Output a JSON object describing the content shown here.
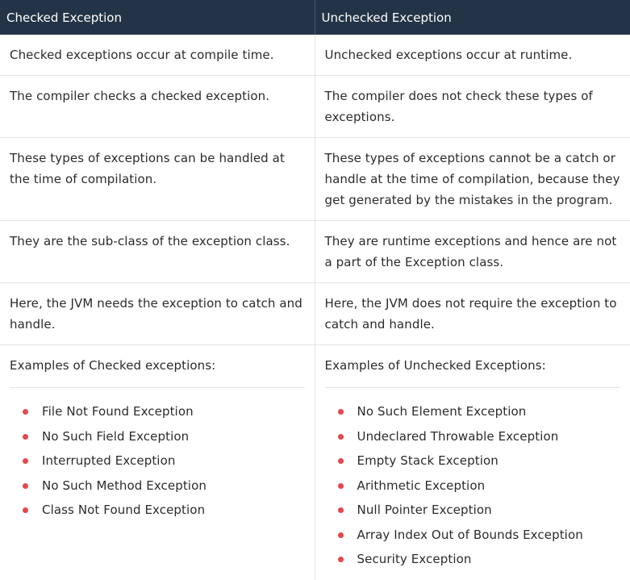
{
  "header": {
    "col1": "Checked Exception",
    "col2": "Unchecked Exception"
  },
  "rows": [
    {
      "checked": "Checked exceptions occur at compile time.",
      "unchecked": "Unchecked exceptions occur at runtime."
    },
    {
      "checked": "The compiler checks a checked exception.",
      "unchecked": "The compiler does not check these types of exceptions."
    },
    {
      "checked": "These types of exceptions can be handled at the time of compilation.",
      "unchecked": "These types of exceptions cannot be a catch or handle at the time of compilation, because they get generated by the mistakes in the program."
    },
    {
      "checked": "They are the sub-class of the exception class.",
      "unchecked": "They are runtime exceptions and hence are not a part of the Exception class."
    },
    {
      "checked": "Here, the JVM needs the exception to catch and handle.",
      "unchecked": "Here, the JVM does not require the exception to catch and handle."
    }
  ],
  "examples": {
    "checked_title": "Examples of Checked exceptions:",
    "unchecked_title": "Examples of Unchecked Exceptions:",
    "checked_items": [
      "File Not Found Exception",
      "No Such Field Exception",
      "Interrupted Exception",
      "No Such Method Exception",
      "Class Not Found Exception"
    ],
    "unchecked_items": [
      "No Such Element Exception",
      "Undeclared Throwable Exception",
      "Empty Stack Exception",
      "Arithmetic Exception",
      "Null Pointer Exception",
      "Array Index Out of Bounds Exception",
      "Security Exception"
    ],
    "bullet_color": "#e8454d"
  },
  "colors": {
    "header_bg": "#243447",
    "header_text": "#ffffff",
    "border": "#e4e4e4"
  }
}
